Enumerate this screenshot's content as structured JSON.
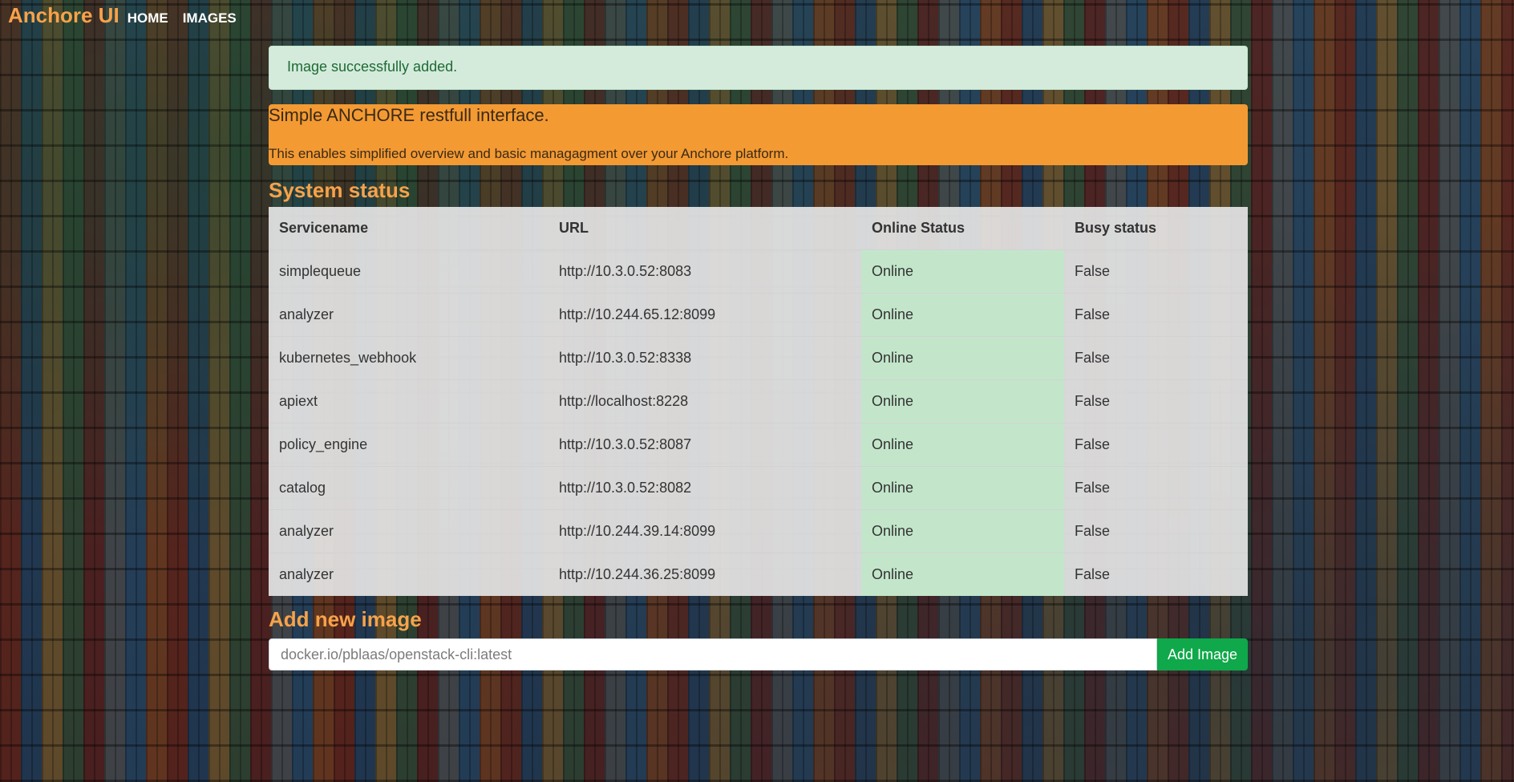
{
  "navbar": {
    "brand": "Anchore UI",
    "links": [
      "HOME",
      "IMAGES"
    ]
  },
  "alert": {
    "message": "Image successfully added."
  },
  "intro": {
    "title": "Simple ANCHORE restfull interface.",
    "text": "This enables simplified overview and basic managagment over your Anchore platform."
  },
  "system_status": {
    "title": "System status",
    "columns": [
      "Servicename",
      "URL",
      "Online Status",
      "Busy status"
    ],
    "rows": [
      {
        "name": "simplequeue",
        "url": "http://10.3.0.52:8083",
        "online": "Online",
        "busy": "False"
      },
      {
        "name": "analyzer",
        "url": "http://10.244.65.12:8099",
        "online": "Online",
        "busy": "False"
      },
      {
        "name": "kubernetes_webhook",
        "url": "http://10.3.0.52:8338",
        "online": "Online",
        "busy": "False"
      },
      {
        "name": "apiext",
        "url": "http://localhost:8228",
        "online": "Online",
        "busy": "False"
      },
      {
        "name": "policy_engine",
        "url": "http://10.3.0.52:8087",
        "online": "Online",
        "busy": "False"
      },
      {
        "name": "catalog",
        "url": "http://10.3.0.52:8082",
        "online": "Online",
        "busy": "False"
      },
      {
        "name": "analyzer",
        "url": "http://10.244.39.14:8099",
        "online": "Online",
        "busy": "False"
      },
      {
        "name": "analyzer",
        "url": "http://10.244.36.25:8099",
        "online": "Online",
        "busy": "False"
      }
    ]
  },
  "add_image": {
    "title": "Add new image",
    "input_value": "",
    "placeholder": "docker.io/pblaas/openstack-cli:latest",
    "button_label": "Add Image"
  },
  "colors": {
    "brand": "#f7a24a",
    "jumbotron": "#f39a33",
    "alert_bg": "#d4ebdc",
    "online_bg": "#c3e6cb",
    "add_button": "#0fa84a"
  }
}
